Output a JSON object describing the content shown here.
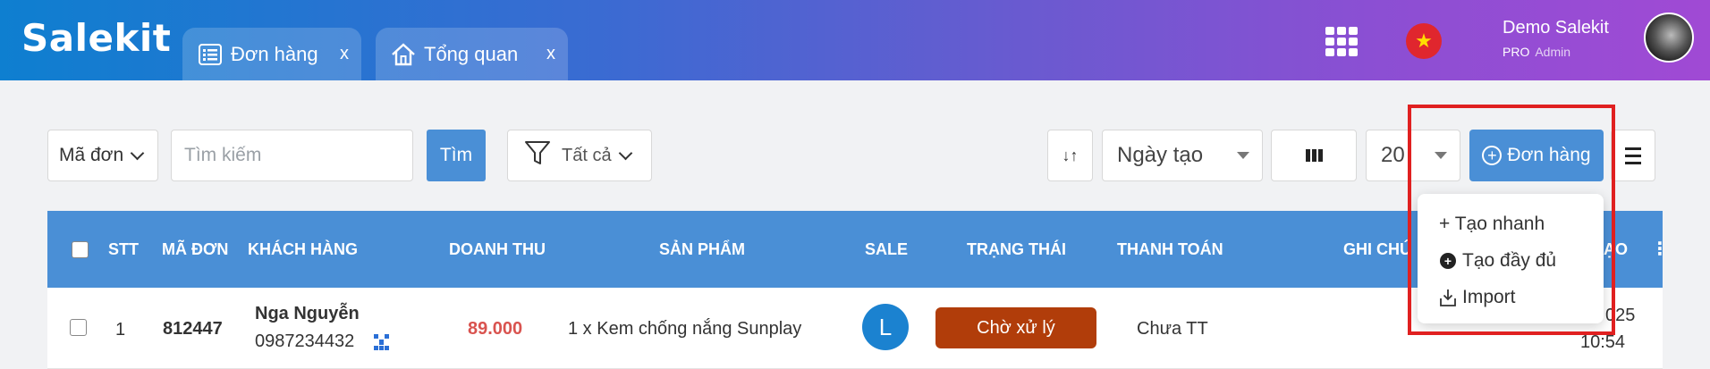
{
  "header": {
    "logo": "Salekit",
    "tabs": [
      {
        "label": "Đơn hàng",
        "close": "x",
        "icon": "list-icon"
      },
      {
        "label": "Tổng quan",
        "close": "x",
        "icon": "home-icon"
      }
    ],
    "apps_icon": "grid-icon",
    "flag_icon": "vietnam-flag-icon",
    "flag_star": "★",
    "user": {
      "name": "Demo Salekit",
      "plan": "PRO",
      "role": "Admin"
    },
    "gradient_colors": [
      "#0e7fd0",
      "#a04ad4"
    ]
  },
  "toolbar": {
    "code_select": "Mã đơn",
    "search_placeholder": "Tìm kiếm",
    "search_button": "Tìm",
    "filter_label": "Tất cả",
    "sort_icon": "↓↑",
    "date_select": "Ngày tạo",
    "page_size": "20",
    "add_button": "Đơn hàng",
    "add_button_icon": "+",
    "accent_color": "#4a8fd6"
  },
  "table": {
    "headers": [
      "STT",
      "MÃ ĐƠN",
      "KHÁCH HÀNG",
      "DOANH THU",
      "SẢN PHẨM",
      "SALE",
      "TRẠNG THÁI",
      "THANH TOÁN",
      "GHI CHÚ",
      "ẠO"
    ],
    "row": {
      "stt": "1",
      "code": "812447",
      "customer_name": "Nga Nguyễn",
      "customer_phone": "0987234432",
      "revenue": "89.000",
      "product": "1 x Kem chống nắng Sunplay",
      "sale_initial": "L",
      "status": "Chờ xử lý",
      "payment": "Chưa TT",
      "date_partial": "025",
      "time": "10:54"
    }
  },
  "dropdown": {
    "items": [
      {
        "label": "+ Tạo nhanh"
      },
      {
        "label": "Tạo đầy đủ",
        "icon": "+"
      },
      {
        "label": "Import",
        "icon": "⤓"
      }
    ]
  },
  "colors": {
    "status": "#b13d0a",
    "revenue": "#d9534f",
    "highlight": "#e02020"
  }
}
